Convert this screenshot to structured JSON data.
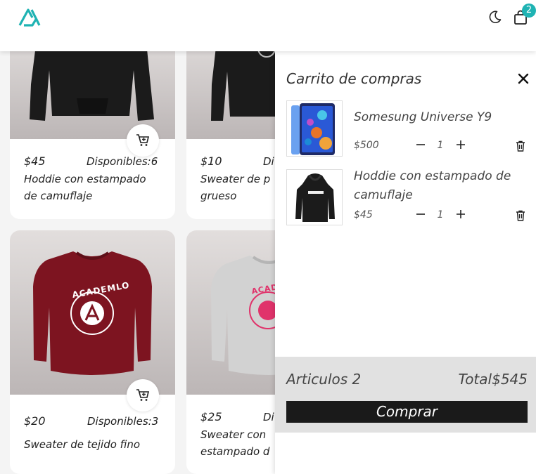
{
  "header": {
    "logo_icon": "academlo-logo",
    "theme_icon": "moon-icon",
    "cart_icon": "shopping-bag-icon",
    "cart_count": "2",
    "accent_color": "#1fb3b3"
  },
  "products": [
    {
      "price": "$45",
      "stock": "Disponibles:6",
      "title_lines": [
        "Hoddie con estampado",
        "de camuflaje"
      ],
      "color": "#1b1b1b"
    },
    {
      "price": "$10",
      "stock": "Di",
      "title_lines": [
        "Sweater de p",
        "grueso"
      ],
      "color": "#1b1b1b"
    },
    {
      "price": "$20",
      "stock": "Disponibles:3",
      "title_lines": [
        "Sweater de tejido fino"
      ],
      "color": "#7d1420",
      "print": "ACADEMLO"
    },
    {
      "price": "$25",
      "stock": "Di",
      "title_lines": [
        "Sweater con",
        "estampado d"
      ],
      "color": "#d2d2d2",
      "print": "ACADEMLO"
    }
  ],
  "cart": {
    "title": "Carrito de compras",
    "items": [
      {
        "name_lines": [
          "Somesung Universe Y9"
        ],
        "price": "$500",
        "qty": "1",
        "image": "phone"
      },
      {
        "name_lines": [
          "Hoddie con estampado de",
          "camuflaje"
        ],
        "price": "$45",
        "qty": "1",
        "image": "hoodie"
      }
    ],
    "articles_label": "Articulos 2",
    "total_label": "Total$545",
    "buy_label": "Comprar"
  }
}
